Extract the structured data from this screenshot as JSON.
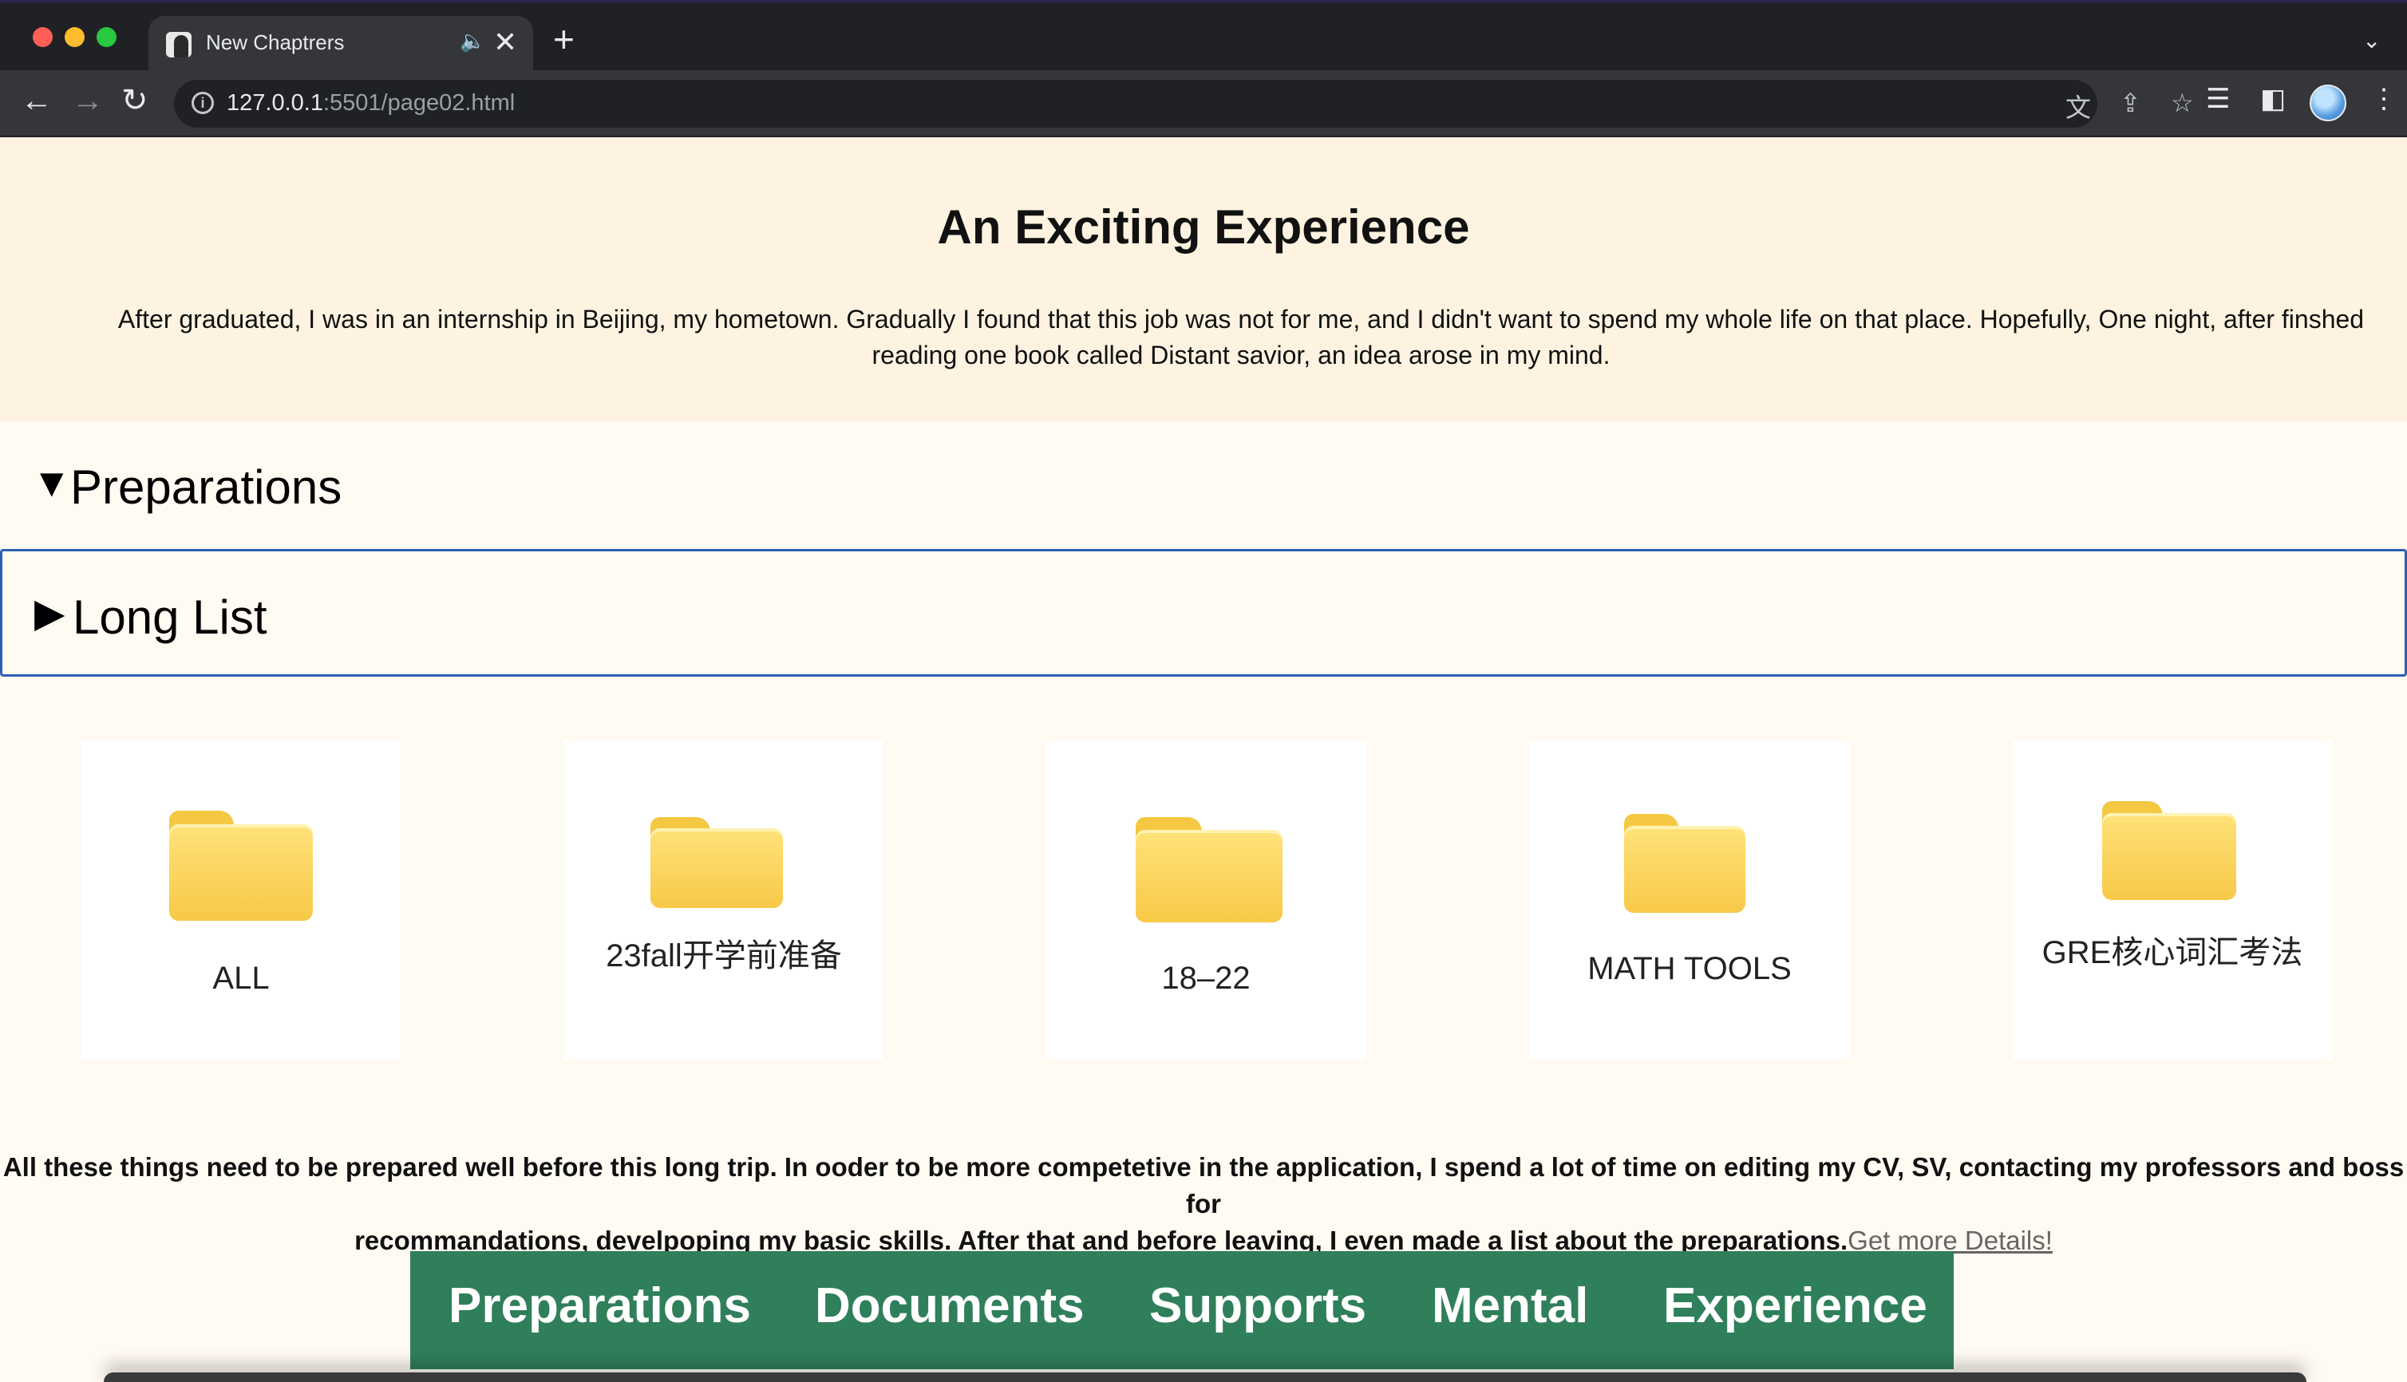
{
  "browser": {
    "tab_title": "New Chaptrers",
    "tab_audio_icon": "speaker-icon",
    "tab_close": "✕",
    "new_tab": "+",
    "url_host": "127.0.0.1",
    "url_path": ":5501/page02.html",
    "icons": [
      "back-arrow-icon",
      "forward-arrow-icon",
      "reload-icon",
      "info-icon",
      "translate-icon",
      "share-icon",
      "star-icon",
      "reading-list-icon",
      "side-panel-icon",
      "profile-avatar",
      "menu-icon"
    ]
  },
  "hero": {
    "title": "An Exciting Experience",
    "text": "After graduated, I was in an internship in Beijing, my hometown. Gradually I found that this job was not for me, and I didn't want to spend my whole life on that place. Hopefully, One night, after finshed reading one book called Distant savior, an idea arose in my mind."
  },
  "sections": {
    "preparations": {
      "label": "Preparations",
      "marker": "▼"
    },
    "long_list": {
      "label": "Long List",
      "marker": "▶"
    }
  },
  "folders": [
    {
      "label": "ALL"
    },
    {
      "label": "23fall开学前准备"
    },
    {
      "label": "18–22"
    },
    {
      "label": "MATH TOOLS"
    },
    {
      "label": "GRE核心词汇考法"
    }
  ],
  "paragraph": {
    "line1": "All these things need to be prepared well before this long trip. In ooder to be more competetive in the application, I spend a lot of time on editing my CV, SV, contacting my professors and boss for",
    "line2": "recommandations, develpoping my basic skills. After that and before leaving, I even made a list about the preparations.",
    "link": "Get more Details!"
  },
  "nav": {
    "items": [
      "Preparations",
      "Documents",
      "Supports",
      "Mental",
      "Experience"
    ],
    "color": "#2f7f5b"
  },
  "colors": {
    "hero_bg": "#fdf3e0",
    "page_bg": "#fffaf2",
    "focus_border": "#2b5fb5",
    "folder_yellow": "#f7c948"
  }
}
